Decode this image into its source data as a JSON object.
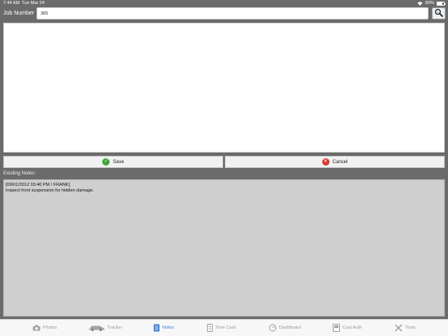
{
  "status_bar": {
    "time": "7:44 AM",
    "date": "Tue Mar 24",
    "battery": "80%",
    "battery_level": 0.8
  },
  "header": {
    "job_number_label": "Job Number",
    "job_number_value": "365"
  },
  "buttons": {
    "save": "Save",
    "cancel": "Cancel"
  },
  "existing_notes": {
    "label": "Existing Notes:",
    "entries": [
      {
        "header": "[09/01/2012 03:40 PM / FRANK]",
        "text": "Inspect front suspension for hidden damage."
      }
    ]
  },
  "tabs": [
    {
      "label": "Photos",
      "icon": "camera-icon",
      "active": false
    },
    {
      "label": "Tracker",
      "icon": "car-icon",
      "active": false
    },
    {
      "label": "Notes",
      "icon": "notes-icon",
      "active": true
    },
    {
      "label": "Time Card",
      "icon": "time-card-icon",
      "active": false
    },
    {
      "label": "Dashboard",
      "icon": "dashboard-icon",
      "active": false
    },
    {
      "label": "Cust Auth",
      "icon": "cust-auth-icon",
      "active": false
    },
    {
      "label": "Tools",
      "icon": "tools-icon",
      "active": false
    }
  ],
  "colors": {
    "background": "#6b6b6b",
    "active_tab": "#3d7fd6",
    "inactive_tab": "#9a9a9a",
    "save_icon": "#3fa535",
    "cancel_icon": "#d63a2c"
  }
}
